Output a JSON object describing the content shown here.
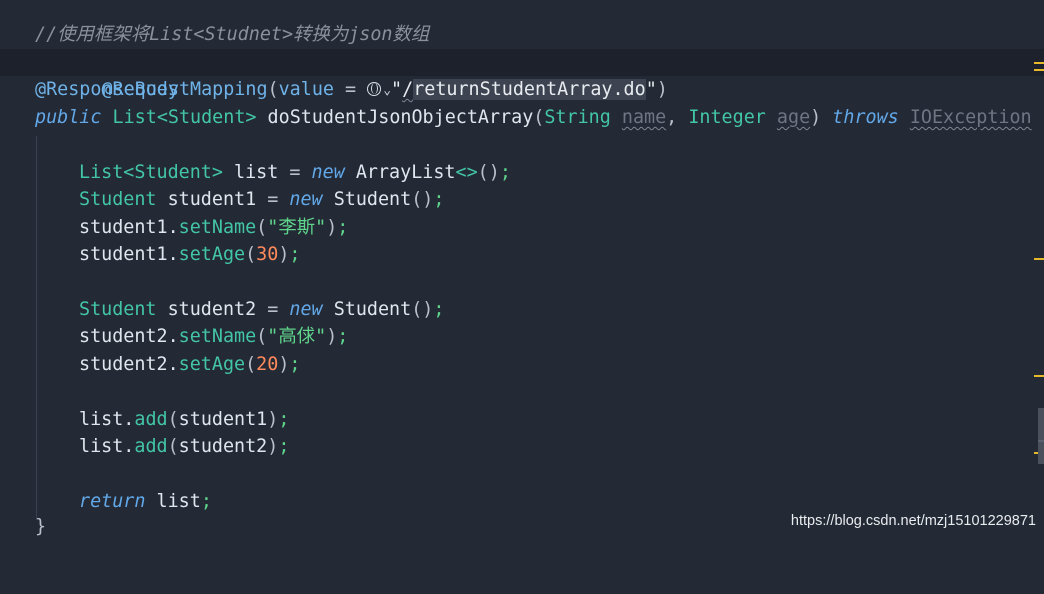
{
  "editor": {
    "comment": "//使用框架将List<Studnet>转换为json数组",
    "mapping": {
      "annotation": "@RequestMapping",
      "open": "(",
      "attr": "value",
      "eq": " = ",
      "quote": "\"",
      "slash": "/",
      "path": "returnStudentArray.do",
      "close_quote": "\"",
      "close": ")"
    },
    "response_body": "@ResponseBody",
    "signature": {
      "kw_public": "public",
      "return_type": "List",
      "generic": "<Student>",
      "method": "doStudentJsonObjectArray",
      "open": "(",
      "type1": "String",
      "param1": "name",
      "comma": ",",
      "type2": "Integer",
      "param2": "age",
      "close": ")",
      "kw_throws": "throws",
      "exception": "IOException",
      "brace": "{"
    },
    "body": {
      "list_decl": {
        "type": "List",
        "generic": "<Student>",
        "var": "list",
        "eq": " = ",
        "kw_new": "new",
        "ctor": "ArrayList",
        "diamond": "<>",
        "call": "()",
        "semi": ";"
      },
      "s1_decl": {
        "type": "Student",
        "var": "student1",
        "eq": " = ",
        "kw_new": "new",
        "ctor": "Student",
        "call": "()",
        "semi": ";"
      },
      "s1_name": {
        "obj": "student1.",
        "method": "setName",
        "open": "(",
        "arg": "\"李斯\"",
        "close": ")",
        "semi": ";"
      },
      "s1_age": {
        "obj": "student1.",
        "method": "setAge",
        "open": "(",
        "arg": "30",
        "close": ")",
        "semi": ";"
      },
      "s2_decl": {
        "type": "Student",
        "var": "student2",
        "eq": " = ",
        "kw_new": "new",
        "ctor": "Student",
        "call": "()",
        "semi": ";"
      },
      "s2_name": {
        "obj": "student2.",
        "method": "setName",
        "open": "(",
        "arg": "\"高俅\"",
        "close": ")",
        "semi": ";"
      },
      "s2_age": {
        "obj": "student2.",
        "method": "setAge",
        "open": "(",
        "arg": "20",
        "close": ")",
        "semi": ";"
      },
      "add1": {
        "obj": "list.",
        "method": "add",
        "open": "(",
        "arg": "student1",
        "close": ")",
        "semi": ";"
      },
      "add2": {
        "obj": "list.",
        "method": "add",
        "open": "(",
        "arg": "student2",
        "close": ")",
        "semi": ";"
      },
      "ret": {
        "kw": "return",
        "val": "list",
        "semi": ";"
      }
    },
    "closing_brace": "}"
  },
  "watermark": "https://blog.csdn.net/mzj15101229871",
  "icons": {
    "url_helper": "globe-icon",
    "dropdown": "chevron-down-icon"
  },
  "colors": {
    "background": "#232935",
    "comment": "#8a919c",
    "keyword": "#62a8e8",
    "type": "#43c6a6",
    "string": "#5fd58c",
    "number": "#ff8a5c",
    "marker": "#e8b82b"
  }
}
